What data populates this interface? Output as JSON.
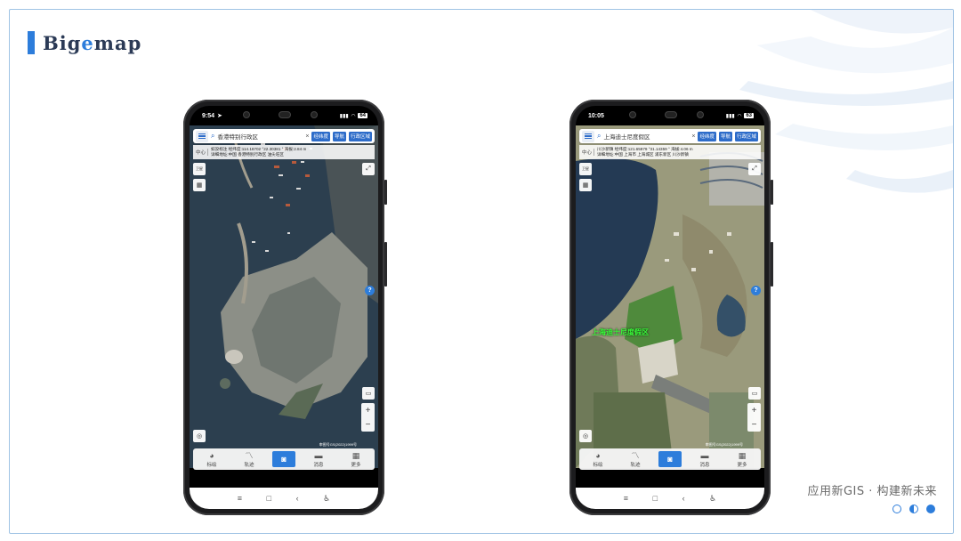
{
  "brand": {
    "prefix": "Big",
    "accent": "e",
    "suffix": "map"
  },
  "slogan": "应用新GIS · 构建新未来",
  "colors": {
    "accent": "#2d7ddb",
    "frame": "#9fc3e4",
    "title": "#2b3a56"
  },
  "pagination": {
    "total": 3,
    "current": 3
  },
  "phones": [
    {
      "status": {
        "time": "9:54",
        "battery": "64"
      },
      "search": {
        "text": "香港特别行政区",
        "clear": "×",
        "btn_coords": "经纬度",
        "btn_nav": "导航",
        "btn_region": "行政区域"
      },
      "info": {
        "center_label": "中心",
        "line1": "如没标注 经纬度:114.16702 °22.30381 ° 海拔:2.84 m",
        "line2": "详细地址:中国 香港特别行政区 油尖旺区"
      },
      "copyright": "审图号GS(2022)1999号",
      "nav": [
        {
          "label": "标绘",
          "icon": "palette-icon"
        },
        {
          "label": "轨迹",
          "icon": "track-icon"
        },
        {
          "label": "",
          "icon": "camera-icon"
        },
        {
          "label": "消息",
          "icon": "message-icon"
        },
        {
          "label": "更多",
          "icon": "grid-icon"
        }
      ]
    },
    {
      "status": {
        "time": "10:05",
        "battery": "63"
      },
      "search": {
        "text": "上海迪士尼度假区",
        "clear": "×",
        "btn_coords": "经纬度",
        "btn_nav": "导航",
        "btn_region": "行政区域"
      },
      "info": {
        "center_label": "中心",
        "line1": "川沙新镇 经纬度:121.65979 °31.14359 ° 海拔:4.06 m",
        "line2": "详细地址:中国 上海市 上海城区 浦东新区 川沙新镇"
      },
      "place_label": "上海迪士尼度假区",
      "copyright": "审图号GS(2022)1999号",
      "nav": [
        {
          "label": "标绘",
          "icon": "palette-icon"
        },
        {
          "label": "轨迹",
          "icon": "track-icon"
        },
        {
          "label": "",
          "icon": "camera-icon"
        },
        {
          "label": "消息",
          "icon": "message-icon"
        },
        {
          "label": "更多",
          "icon": "grid-icon"
        }
      ]
    }
  ]
}
